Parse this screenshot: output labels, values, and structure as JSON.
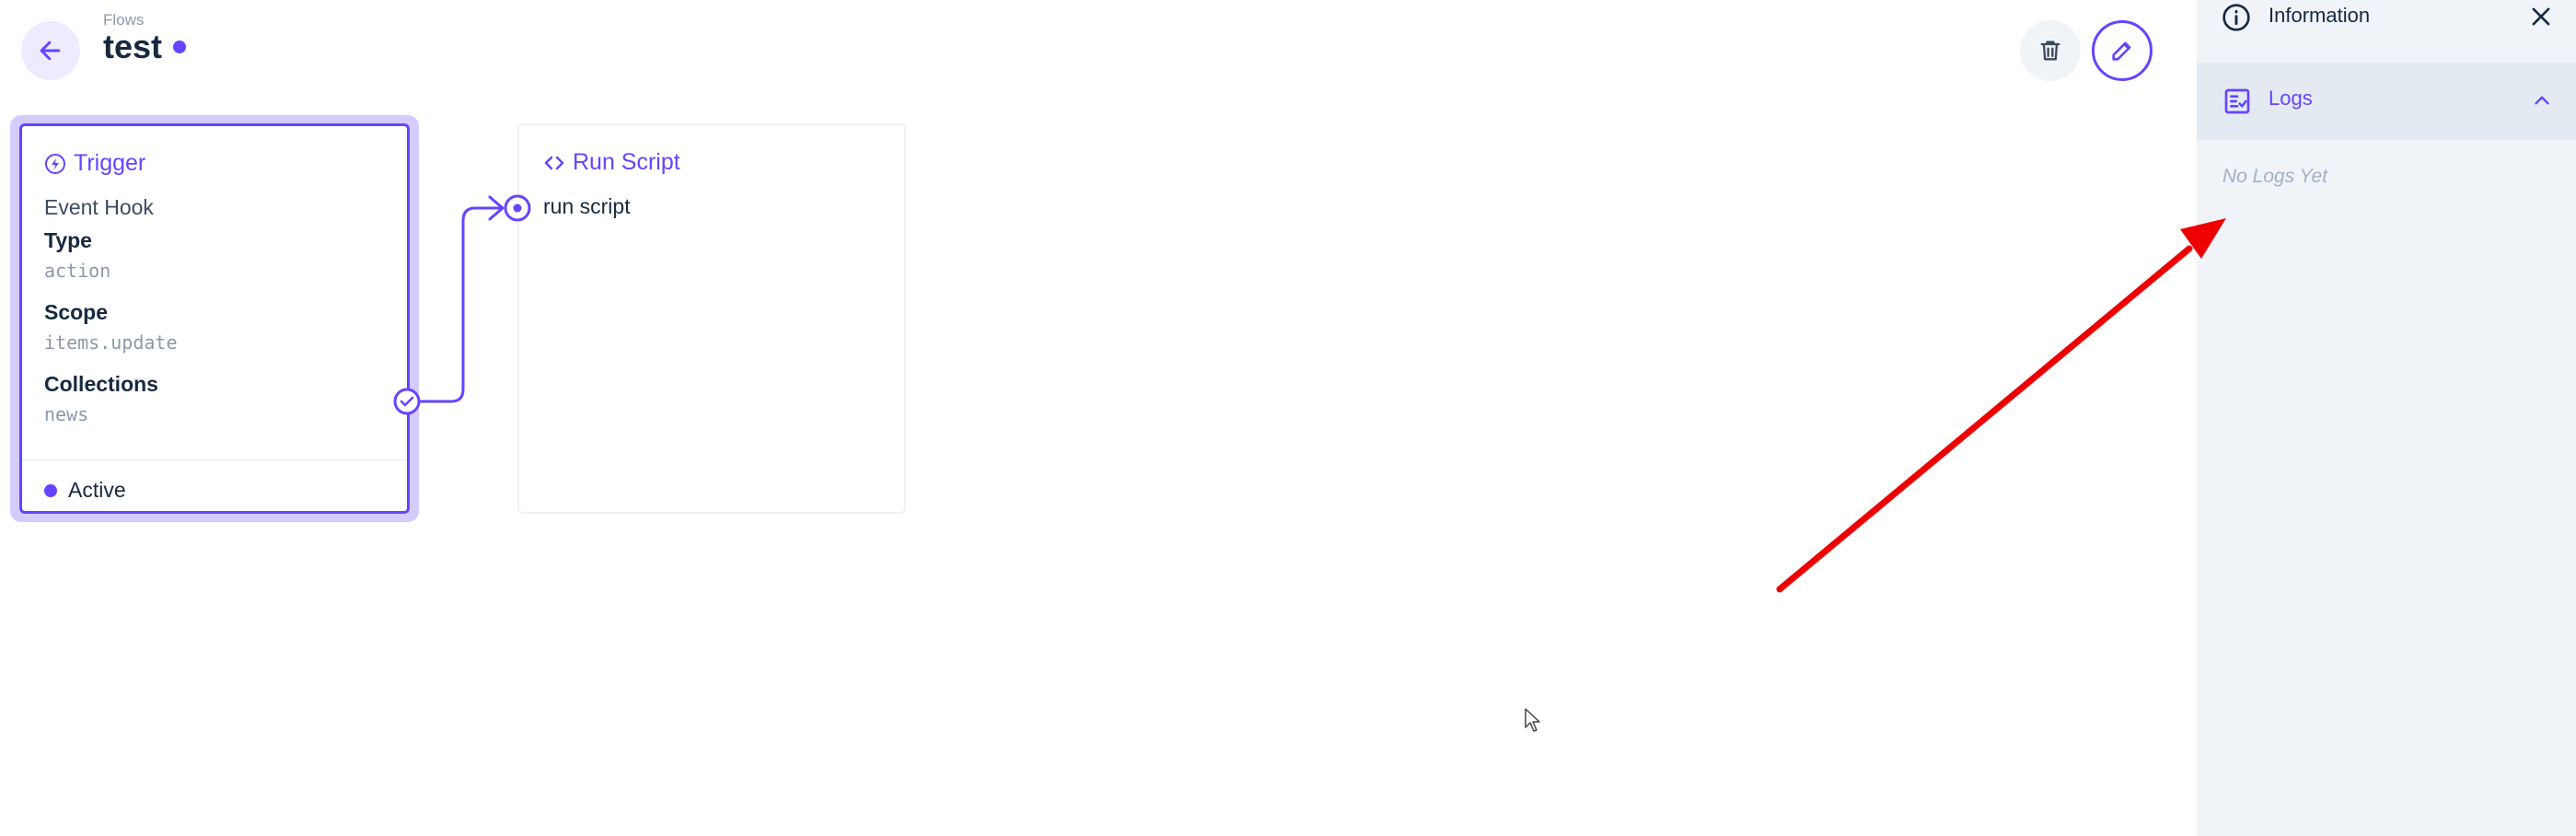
{
  "header": {
    "breadcrumb": "Flows",
    "title": "test"
  },
  "trigger": {
    "title": "Trigger",
    "event": "Event Hook",
    "type_label": "Type",
    "type_value": "action",
    "scope_label": "Scope",
    "scope_value": "items.update",
    "collections_label": "Collections",
    "collections_value": "news",
    "status": "Active"
  },
  "operation": {
    "title": "Run Script",
    "description": "run script"
  },
  "sidebar": {
    "information_label": "Information",
    "logs_label": "Logs",
    "empty_logs": "No Logs Yet"
  },
  "colors": {
    "accent": "#6644ff",
    "annotation_arrow": "#ee0000",
    "sidebar_bg": "#f0f4f9"
  },
  "icons": [
    "arrow-back-icon",
    "trash-icon",
    "pencil-icon",
    "bolt-icon",
    "code-icon",
    "check-circle-icon",
    "target-icon",
    "info-icon",
    "close-icon",
    "logs-icon",
    "chevron-up-icon",
    "mouse-pointer-icon"
  ]
}
